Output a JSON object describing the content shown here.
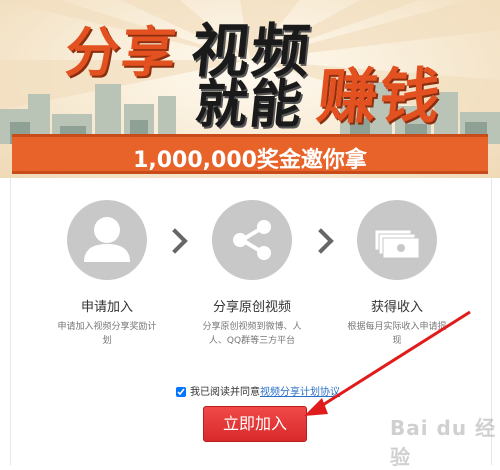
{
  "banner": {
    "headline_1a": "分享",
    "headline_1b": "视频",
    "headline_2a": "就能",
    "headline_2b": "赚钱",
    "prize": "1,000,000奖金邀你拿"
  },
  "steps": [
    {
      "icon": "user-icon",
      "title": "申请加入",
      "desc": "申请加入视频分享奖励计划"
    },
    {
      "icon": "share-icon",
      "title": "分享原创视频",
      "desc": "分享原创视频到微博、人人、QQ群等三方平台"
    },
    {
      "icon": "cash-icon",
      "title": "获得收入",
      "desc": "根据每月实际收入申请提现"
    }
  ],
  "agreement": {
    "prefix": "我已阅读并同意",
    "link": "视频分享计划协议"
  },
  "join_button": "立即加入",
  "watermark": "Bai du 经验",
  "colors": {
    "accent": "#e8632a",
    "button": "#e03333",
    "link": "#2a6fc9"
  }
}
